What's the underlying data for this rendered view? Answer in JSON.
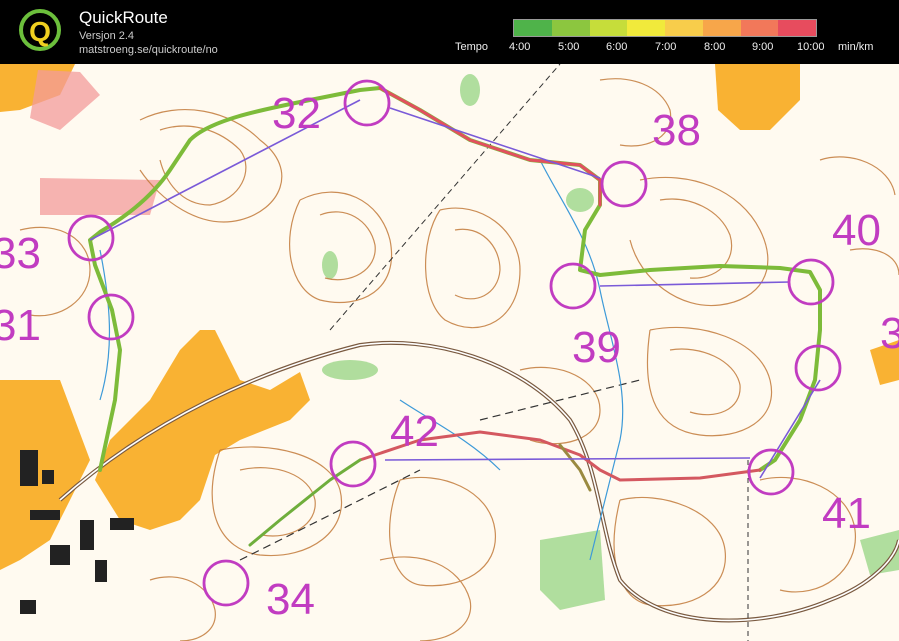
{
  "app": {
    "title": "QuickRoute",
    "version": "Versjon 2.4",
    "url": "matstroeng.se/quickroute/no"
  },
  "pace_scale": {
    "label": "Tempo",
    "ticks": [
      "4:00",
      "5:00",
      "6:00",
      "7:00",
      "8:00",
      "9:00",
      "10:00"
    ],
    "unit": "min/km",
    "colors": [
      "#4fb34a",
      "#8cc63f",
      "#c6dd3a",
      "#f1ea3b",
      "#f8cd4b",
      "#f7a64a",
      "#f2785a",
      "#e74c5e"
    ]
  },
  "controls": [
    "32",
    "33",
    "31",
    "38",
    "40",
    "39",
    "42",
    "41",
    "34",
    "3"
  ],
  "colors": {
    "map_bg": "#fffaf0",
    "control_magenta": "#c13cc1",
    "open_land": "#f9b233",
    "contour_brown": "#c27a3a"
  }
}
